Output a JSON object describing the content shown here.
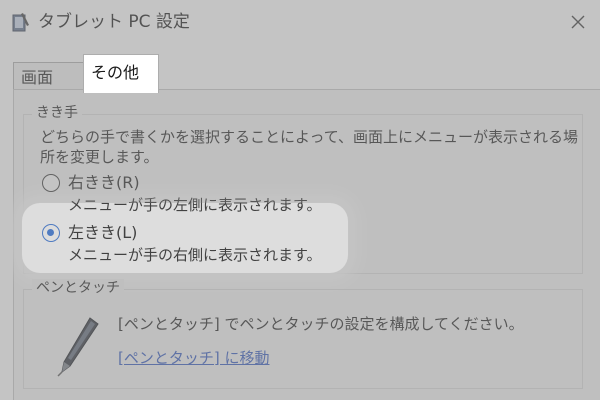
{
  "window": {
    "title": "タブレット PC 設定",
    "close_icon": "close-icon",
    "app_icon": "tablet-pc-settings-icon"
  },
  "tabs": [
    {
      "label": "画面",
      "selected": false
    },
    {
      "label": "その他",
      "selected": true
    }
  ],
  "handedness": {
    "group_title": "きき手",
    "description": "どちらの手で書くかを選択することによって、画面上にメニューが表示される場所を変更します。",
    "options": [
      {
        "label": "右きき(R)",
        "sub": "メニューが手の左側に表示されます。",
        "selected": false
      },
      {
        "label": "左きき(L)",
        "sub": "メニューが手の右側に表示されます。",
        "selected": true
      }
    ]
  },
  "pen": {
    "group_title": "ペンとタッチ",
    "text": "[ペンとタッチ] でペンとタッチの設定を構成してください。",
    "link": "[ペンとタッチ] に移動",
    "icon": "pen-icon"
  },
  "colors": {
    "accent": "#2f6fd6",
    "link": "#2a52be"
  }
}
